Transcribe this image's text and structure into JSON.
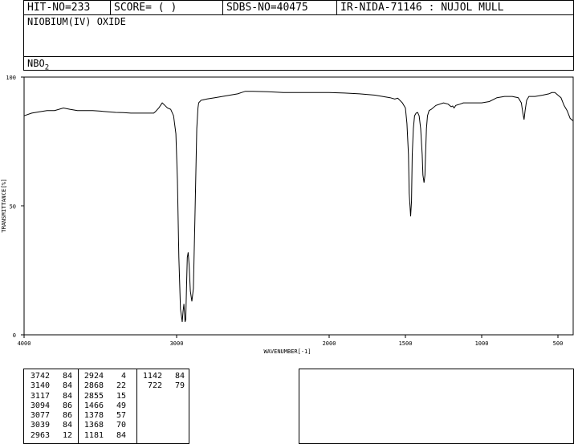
{
  "header": {
    "hit_no": "HIT-NO=233",
    "score": "SCORE=  (   )",
    "sdbs_no": "SDBS-NO=40475",
    "ir_info": "IR-NIDA-71146 : NUJOL MULL"
  },
  "compound_name": "NIOBIUM(IV) OXIDE",
  "formula": "NBO",
  "formula_sub": "2",
  "chart_data": {
    "type": "line",
    "xlabel": "WAVENUMBER[-1]",
    "ylabel": "TRANSMITTANCE[%]",
    "xlim": [
      4000,
      400
    ],
    "ylim": [
      0,
      100
    ],
    "xticks": [
      4000,
      3000,
      2000,
      1500,
      1000,
      500
    ],
    "yticks": [
      0,
      50,
      100
    ],
    "series": [
      {
        "points": [
          [
            4000,
            85
          ],
          [
            3950,
            86
          ],
          [
            3900,
            86.5
          ],
          [
            3850,
            87
          ],
          [
            3800,
            87
          ],
          [
            3742,
            88
          ],
          [
            3700,
            87.5
          ],
          [
            3650,
            87
          ],
          [
            3600,
            87
          ],
          [
            3550,
            87
          ],
          [
            3500,
            86.8
          ],
          [
            3450,
            86.5
          ],
          [
            3400,
            86.3
          ],
          [
            3350,
            86.2
          ],
          [
            3300,
            86
          ],
          [
            3250,
            86
          ],
          [
            3200,
            86
          ],
          [
            3150,
            86
          ],
          [
            3140,
            86.5
          ],
          [
            3117,
            88
          ],
          [
            3100,
            89.5
          ],
          [
            3094,
            90
          ],
          [
            3077,
            89
          ],
          [
            3060,
            88
          ],
          [
            3039,
            87.5
          ],
          [
            3020,
            85
          ],
          [
            3005,
            78
          ],
          [
            2995,
            60
          ],
          [
            2985,
            30
          ],
          [
            2975,
            10
          ],
          [
            2963,
            5
          ],
          [
            2958,
            9
          ],
          [
            2952,
            12
          ],
          [
            2945,
            5
          ],
          [
            2940,
            6
          ],
          [
            2935,
            18
          ],
          [
            2930,
            30
          ],
          [
            2924,
            32
          ],
          [
            2918,
            27
          ],
          [
            2910,
            17
          ],
          [
            2900,
            13
          ],
          [
            2890,
            18
          ],
          [
            2880,
            45
          ],
          [
            2868,
            80
          ],
          [
            2860,
            88
          ],
          [
            2855,
            90
          ],
          [
            2840,
            91
          ],
          [
            2800,
            91.5
          ],
          [
            2750,
            92
          ],
          [
            2700,
            92.5
          ],
          [
            2650,
            93
          ],
          [
            2600,
            93.5
          ],
          [
            2550,
            94.5
          ],
          [
            2500,
            94.5
          ],
          [
            2400,
            94.3
          ],
          [
            2300,
            94
          ],
          [
            2200,
            94
          ],
          [
            2100,
            94
          ],
          [
            2000,
            94
          ],
          [
            1900,
            93.8
          ],
          [
            1800,
            93.5
          ],
          [
            1700,
            93
          ],
          [
            1650,
            92.5
          ],
          [
            1600,
            92
          ],
          [
            1570,
            91.5
          ],
          [
            1550,
            91.8
          ],
          [
            1520,
            90
          ],
          [
            1500,
            88
          ],
          [
            1490,
            82
          ],
          [
            1480,
            70
          ],
          [
            1475,
            55
          ],
          [
            1466,
            46
          ],
          [
            1460,
            52
          ],
          [
            1455,
            70
          ],
          [
            1448,
            80
          ],
          [
            1440,
            85
          ],
          [
            1430,
            86
          ],
          [
            1420,
            86.3
          ],
          [
            1410,
            85
          ],
          [
            1400,
            80
          ],
          [
            1390,
            70
          ],
          [
            1385,
            62
          ],
          [
            1378,
            59
          ],
          [
            1372,
            62
          ],
          [
            1368,
            70
          ],
          [
            1362,
            80
          ],
          [
            1355,
            85
          ],
          [
            1345,
            87
          ],
          [
            1330,
            87.5
          ],
          [
            1300,
            89
          ],
          [
            1250,
            90
          ],
          [
            1220,
            89.5
          ],
          [
            1200,
            88.5
          ],
          [
            1190,
            88.8
          ],
          [
            1181,
            88
          ],
          [
            1170,
            89
          ],
          [
            1142,
            89.5
          ],
          [
            1120,
            90
          ],
          [
            1100,
            90
          ],
          [
            1060,
            90
          ],
          [
            1030,
            90
          ],
          [
            1000,
            90
          ],
          [
            950,
            90.5
          ],
          [
            900,
            92
          ],
          [
            850,
            92.5
          ],
          [
            800,
            92.5
          ],
          [
            760,
            92
          ],
          [
            740,
            90
          ],
          [
            730,
            86
          ],
          [
            722,
            83.5
          ],
          [
            715,
            87
          ],
          [
            705,
            91
          ],
          [
            690,
            92.5
          ],
          [
            650,
            92.5
          ],
          [
            600,
            93
          ],
          [
            560,
            93.5
          ],
          [
            540,
            94
          ],
          [
            520,
            94
          ],
          [
            500,
            93
          ],
          [
            480,
            92
          ],
          [
            460,
            89
          ],
          [
            440,
            87
          ],
          [
            420,
            84
          ],
          [
            400,
            83
          ]
        ]
      }
    ]
  },
  "peak_table": {
    "col1": [
      [
        "3742",
        "84"
      ],
      [
        "3140",
        "84"
      ],
      [
        "3117",
        "84"
      ],
      [
        "3094",
        "86"
      ],
      [
        "3077",
        "86"
      ],
      [
        "3039",
        "84"
      ],
      [
        "2963",
        "12"
      ]
    ],
    "col2": [
      [
        "2924",
        "4"
      ],
      [
        "2868",
        "22"
      ],
      [
        "2855",
        "15"
      ],
      [
        "1466",
        "49"
      ],
      [
        "1378",
        "57"
      ],
      [
        "1368",
        "70"
      ],
      [
        "1181",
        "84"
      ]
    ],
    "col3": [
      [
        "1142",
        "84"
      ],
      [
        "722",
        "79"
      ]
    ]
  }
}
